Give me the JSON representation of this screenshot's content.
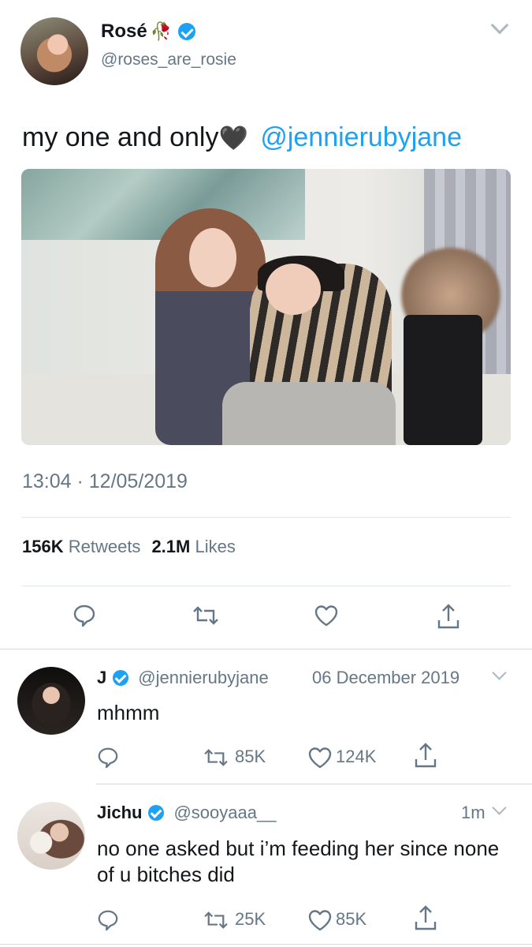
{
  "main_tweet": {
    "author_name": "Rosé",
    "author_emoji": "🥀",
    "author_handle": "@roses_are_rosie",
    "text": "my one and only",
    "text_emoji": "🖤",
    "mention": "@jennierubyjane",
    "timestamp": "13:04 · 12/05/2019",
    "stats": {
      "retweets_count": "156K",
      "retweets_label": "Retweets",
      "likes_count": "2.1M",
      "likes_label": "Likes"
    },
    "actions": [
      "reply-icon",
      "retweet-icon",
      "like-icon",
      "share-icon"
    ]
  },
  "replies": [
    {
      "name": "J",
      "handle": "@jennierubyjane",
      "date": "06 December 2019",
      "text": "mhmm",
      "retweets": "85K",
      "likes": "124K"
    },
    {
      "name": "Jichu",
      "handle": "@sooyaaa__",
      "date": "1m",
      "text": "no one asked but i’m feeding her since none of u bitches did",
      "retweets": "25K",
      "likes": "85K"
    }
  ],
  "colors": {
    "link_blue": "#1da1f2",
    "secondary_gray": "#657786",
    "text_dark": "#14171a",
    "icon_gray": "#657786"
  }
}
